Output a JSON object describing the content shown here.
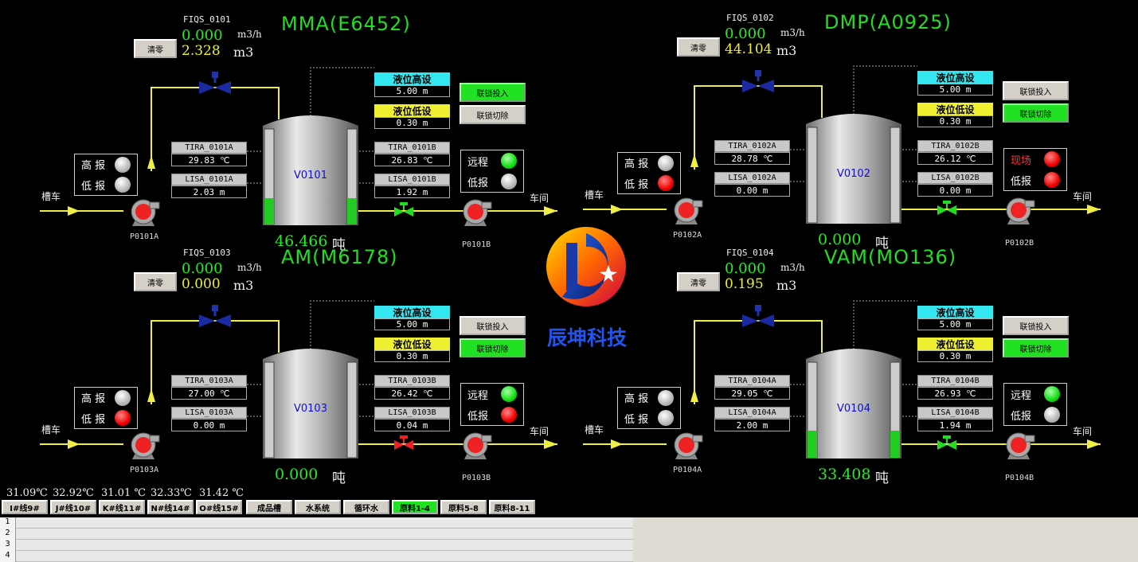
{
  "colors": {
    "accent_green": "#22dd22",
    "value_yellow": "#eeee33",
    "level_high": "#33e6f0",
    "level_low": "#f0f033",
    "alarm_red": "#ee0000"
  },
  "logo": {
    "text": "辰坤科技"
  },
  "common": {
    "reset_label": "清零",
    "flow_unit": "m3/h",
    "total_unit": "m3",
    "ton_unit": "吨",
    "lvl_high_label": "液位高设",
    "lvl_low_label": "液位低设",
    "interlock_on": "联锁投入",
    "interlock_off": "联锁切除",
    "tanker": "槽车",
    "workshop": "车间",
    "high_alarm": "高 报",
    "low_alarm": "低 报",
    "remote": "远程",
    "low_alarm2": "低报",
    "site": "现场"
  },
  "units": [
    {
      "title": "MMA(E6452)",
      "fiqs": "FIQS_0101",
      "flow": "0.000",
      "total": "2.328",
      "high_set": "5.00  m",
      "low_set": "0.30  m",
      "tira_a": "TIRA_0101A",
      "tira_a_val": "29.83  ℃",
      "lisa_a": "LISA_0101A",
      "lisa_a_val": "2.03  m",
      "tira_b": "TIRA_0101B",
      "tira_b_val": "26.83  ℃",
      "lisa_b": "LISA_0101B",
      "lisa_b_val": "1.92  m",
      "tank": "V0101",
      "ton": "46.466",
      "pump_a": "P0101A",
      "pump_b": "P0101B",
      "right_lbl1": "远程",
      "right_lamp1": "green",
      "right_lamp2": "gray",
      "high_lamp": "gray",
      "low_lamp": "gray",
      "level_fill": 0.25,
      "on_active": true,
      "valve": "green"
    },
    {
      "title": "DMP(A0925)",
      "fiqs": "FIQS_0102",
      "flow": "0.000",
      "total": "44.104",
      "high_set": "5.00  m",
      "low_set": "0.30  m",
      "tira_a": "TIRA_0102A",
      "tira_a_val": "28.78  ℃",
      "lisa_a": "LISA_0102A",
      "lisa_a_val": "0.00  m",
      "tira_b": "TIRA_0102B",
      "tira_b_val": "26.12  ℃",
      "lisa_b": "LISA_0102B",
      "lisa_b_val": "0.00  m",
      "tank": "V0102",
      "ton": "0.000",
      "pump_a": "P0102A",
      "pump_b": "P0102B",
      "right_lbl1": "现场",
      "right_lamp1": "red",
      "right_lamp2": "red",
      "high_lamp": "gray",
      "low_lamp": "red",
      "level_fill": 0,
      "on_active": false,
      "valve": "green"
    },
    {
      "title": "AM(M6178)",
      "fiqs": "FIQS_0103",
      "flow": "0.000",
      "total": "0.000",
      "high_set": "5.00  m",
      "low_set": "0.30  m",
      "tira_a": "TIRA_0103A",
      "tira_a_val": "27.00  ℃",
      "lisa_a": "LISA_0103A",
      "lisa_a_val": "0.00  m",
      "tira_b": "TIRA_0103B",
      "tira_b_val": "26.42  ℃",
      "lisa_b": "LISA_0103B",
      "lisa_b_val": "0.04  m",
      "tank": "V0103",
      "ton": "0.000",
      "pump_a": "P0103A",
      "pump_b": "P0103B",
      "right_lbl1": "远程",
      "right_lamp1": "green",
      "right_lamp2": "red",
      "high_lamp": "gray",
      "low_lamp": "red",
      "level_fill": 0,
      "on_active": false,
      "valve": "red"
    },
    {
      "title": "VAM(MO136)",
      "fiqs": "FIQS_0104",
      "flow": "0.000",
      "total": "0.195",
      "high_set": "5.00  m",
      "low_set": "0.30  m",
      "tira_a": "TIRA_0104A",
      "tira_a_val": "29.05  ℃",
      "lisa_a": "LISA_0104A",
      "lisa_a_val": "2.00  m",
      "tira_b": "TIRA_0104B",
      "tira_b_val": "26.93  ℃",
      "lisa_b": "LISA_0104B",
      "lisa_b_val": "1.94  m",
      "tank": "V0104",
      "ton": "33.408",
      "pump_a": "P0104A",
      "pump_b": "P0104B",
      "right_lbl1": "远程",
      "right_lamp1": "green",
      "right_lamp2": "gray",
      "high_lamp": "gray",
      "low_lamp": "gray",
      "level_fill": 0.3,
      "on_active": false,
      "valve": "green"
    }
  ],
  "bottom": {
    "temps": [
      "31.09℃",
      "32.92℃",
      "31.01 ℃",
      "32.33℃",
      "31.42 ℃"
    ],
    "tabs": [
      "I#线9#",
      "J#线10#",
      "K#线11#",
      "N#线14#",
      "O#线15#",
      "成品槽",
      "水系统",
      "循环水",
      "原料1-4",
      "原料5-8",
      "原料8-11"
    ],
    "active_tab": 8,
    "rows": [
      "1",
      "2",
      "3",
      "4"
    ]
  }
}
